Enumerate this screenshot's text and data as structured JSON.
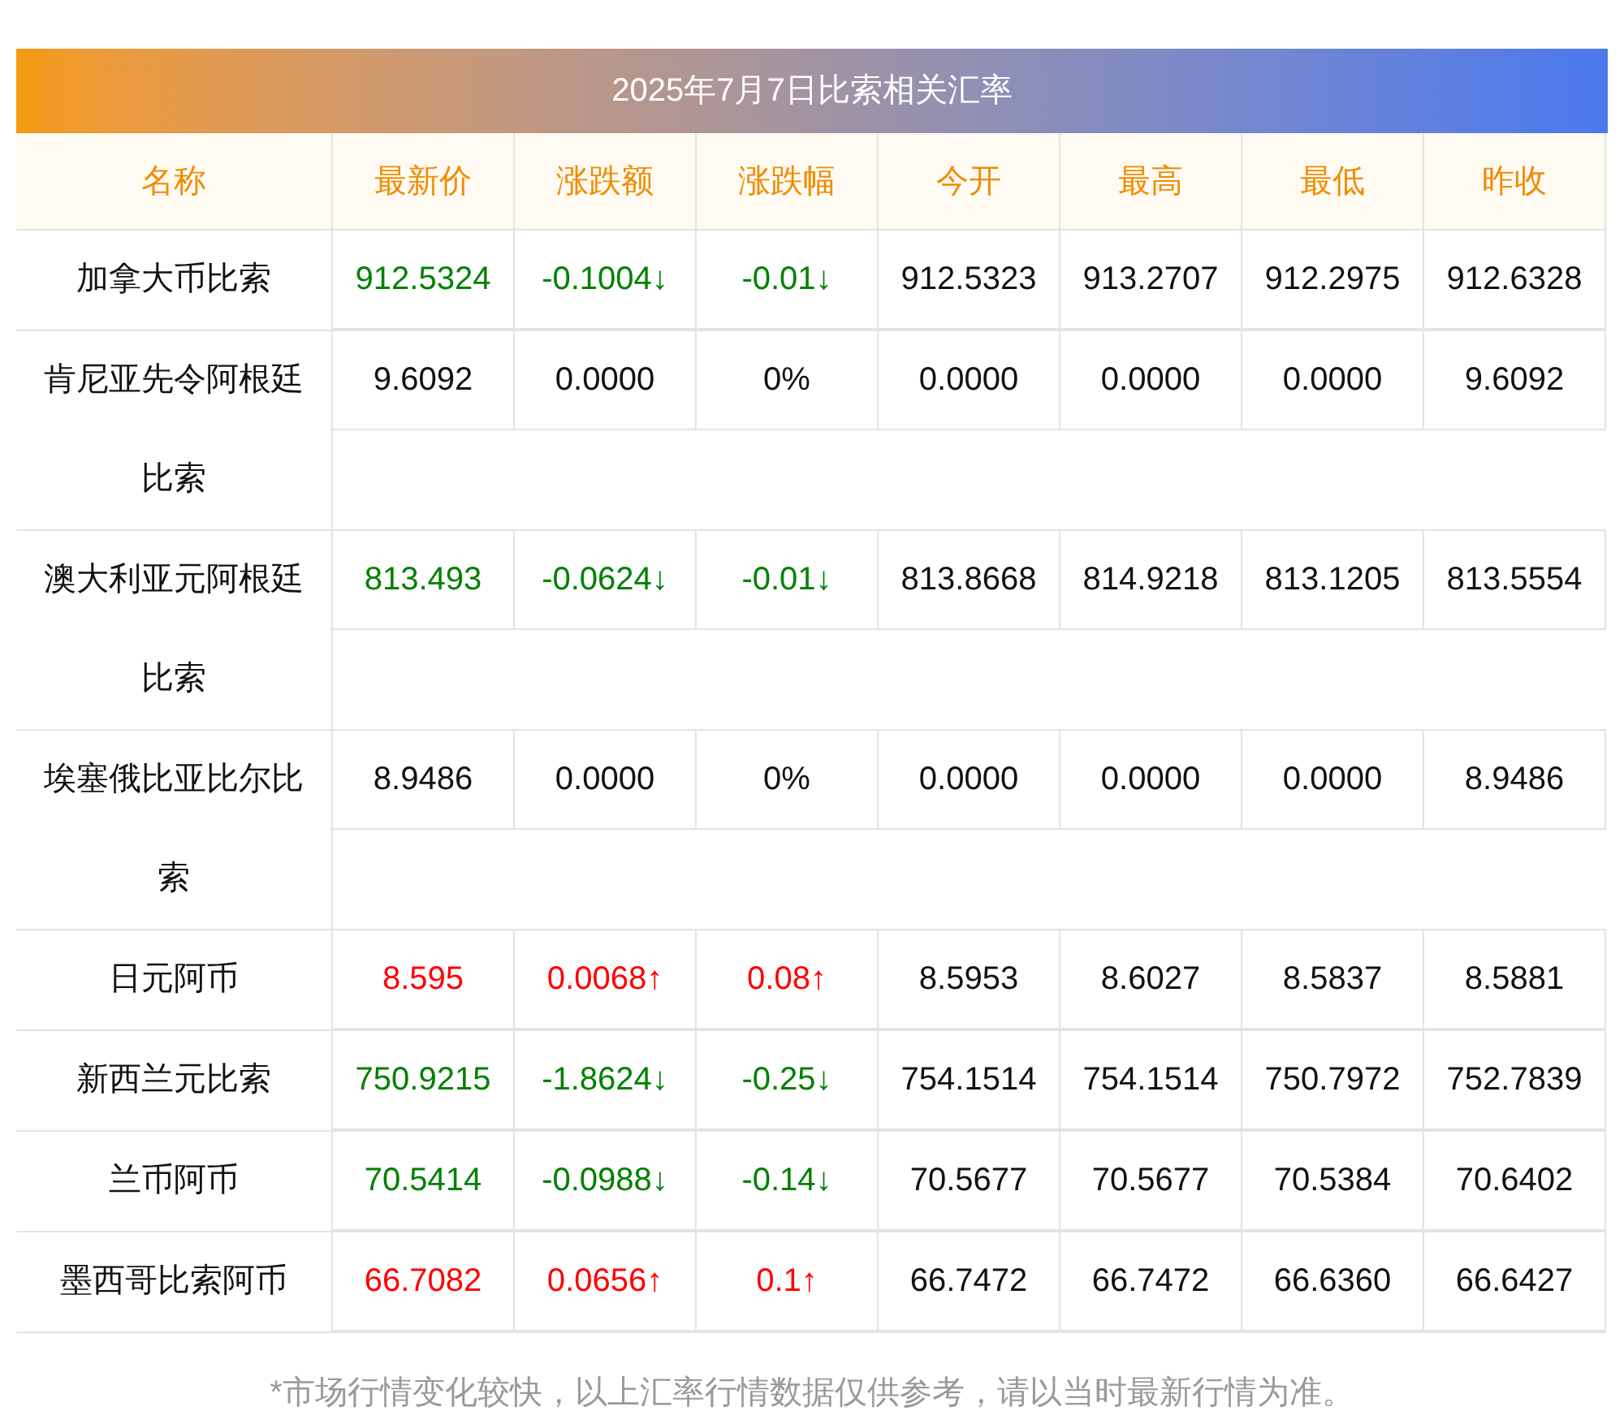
{
  "title": "2025年7月7日比索相关汇率",
  "columns": [
    "名称",
    "最新价",
    "涨跌额",
    "涨跌幅",
    "今开",
    "最高",
    "最低",
    "昨收"
  ],
  "rows": [
    {
      "name": "加拿大币比索",
      "color": "#008000",
      "cells": [
        "912.5324",
        "-0.1004↓",
        "-0.01↓",
        "912.5323",
        "913.2707",
        "912.2975",
        "912.6328"
      ]
    },
    {
      "name": "肯尼亚先令阿根廷比索",
      "color": "#111111",
      "cells": [
        "9.6092",
        "0.0000",
        "0%",
        "0.0000",
        "0.0000",
        "0.0000",
        "9.6092"
      ]
    },
    {
      "name": "澳大利亚元阿根廷比索",
      "color": "#008000",
      "cells": [
        "813.493",
        "-0.0624↓",
        "-0.01↓",
        "813.8668",
        "814.9218",
        "813.1205",
        "813.5554"
      ]
    },
    {
      "name": "埃塞俄比亚比尔比索",
      "color": "#111111",
      "cells": [
        "8.9486",
        "0.0000",
        "0%",
        "0.0000",
        "0.0000",
        "0.0000",
        "8.9486"
      ]
    },
    {
      "name": "日元阿币",
      "color": "#ff0000",
      "cells": [
        "8.595",
        "0.0068↑",
        "0.08↑",
        "8.5953",
        "8.6027",
        "8.5837",
        "8.5881"
      ]
    },
    {
      "name": "新西兰元比索",
      "color": "#008000",
      "cells": [
        "750.9215",
        "-1.8624↓",
        "-0.25↓",
        "754.1514",
        "754.1514",
        "750.7972",
        "752.7839"
      ]
    },
    {
      "name": "兰币阿币",
      "color": "#008000",
      "cells": [
        "70.5414",
        "-0.0988↓",
        "-0.14↓",
        "70.5677",
        "70.5677",
        "70.5384",
        "70.6402"
      ]
    },
    {
      "name": "墨西哥比索阿币",
      "color": "#ff0000",
      "cells": [
        "66.7082",
        "0.0656↑",
        "0.1↑",
        "66.7472",
        "66.7472",
        "66.6360",
        "66.6427"
      ]
    }
  ],
  "footnote": "*市场行情变化较快，以上汇率行情数据仅供参考，请以当时最新行情为准。"
}
